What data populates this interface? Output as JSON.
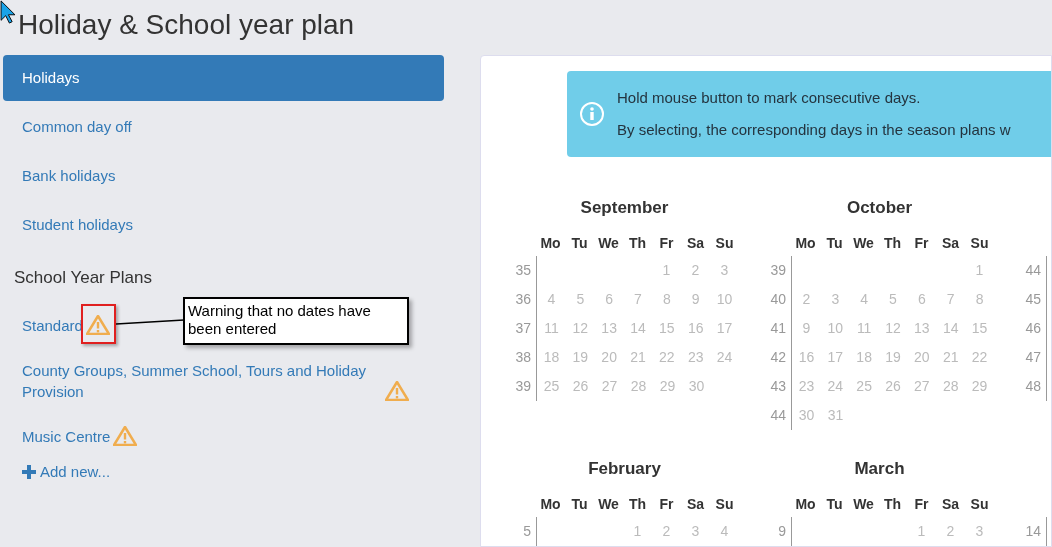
{
  "page_title": "Holiday & School year plan",
  "nav": [
    {
      "label": "Holidays",
      "selected": true
    },
    {
      "label": "Common day off",
      "selected": false
    },
    {
      "label": "Bank holidays",
      "selected": false
    },
    {
      "label": "Student holidays",
      "selected": false
    }
  ],
  "plans_heading": "School Year Plans",
  "plans": [
    {
      "label": "Standard",
      "warning": true
    },
    {
      "label": "County Groups, Summer School, Tours and Holiday Provision",
      "warning": true
    },
    {
      "label": "Music Centre",
      "warning": true
    }
  ],
  "add_new": "Add new...",
  "annotation": {
    "text": "Warning that no dates have been entered"
  },
  "info": {
    "lines": [
      "Hold mouse button to mark consecutive days.",
      "By selecting, the corresponding days in the season plans w"
    ]
  },
  "calendar": {
    "month_rows": [
      [
        {
          "title": "September",
          "weekdays": [
            "Mo",
            "Tu",
            "We",
            "Th",
            "Fr",
            "Sa",
            "Su"
          ],
          "weeks": [
            {
              "number": "35",
              "starts_mid_week": true,
              "days": [
                "1",
                "2",
                "3"
              ]
            },
            {
              "number": "36",
              "days": [
                "4",
                "5",
                "6",
                "7",
                "8",
                "9",
                "10"
              ]
            },
            {
              "number": "37",
              "days": [
                "11",
                "12",
                "13",
                "14",
                "15",
                "16",
                "17"
              ]
            },
            {
              "number": "38",
              "days": [
                "18",
                "19",
                "20",
                "21",
                "22",
                "23",
                "24"
              ]
            },
            {
              "number": "39",
              "starts_mid_week": false,
              "days": [
                "25",
                "26",
                "27",
                "28",
                "29",
                "30"
              ]
            }
          ]
        },
        {
          "title": "October",
          "weekdays": [
            "Mo",
            "Tu",
            "We",
            "Th",
            "Fr",
            "Sa",
            "Su"
          ],
          "weeks": [
            {
              "number": "39",
              "starts_mid_week": true,
              "days": [
                "1"
              ]
            },
            {
              "number": "40",
              "days": [
                "2",
                "3",
                "4",
                "5",
                "6",
                "7",
                "8"
              ]
            },
            {
              "number": "41",
              "days": [
                "9",
                "10",
                "11",
                "12",
                "13",
                "14",
                "15"
              ]
            },
            {
              "number": "42",
              "days": [
                "16",
                "17",
                "18",
                "19",
                "20",
                "21",
                "22"
              ]
            },
            {
              "number": "43",
              "days": [
                "23",
                "24",
                "25",
                "26",
                "27",
                "28",
                "29"
              ]
            },
            {
              "number": "44",
              "starts_mid_week": false,
              "days": [
                "30",
                "31"
              ]
            }
          ]
        },
        {
          "weeks": [
            {
              "number": "44"
            },
            {
              "number": "45"
            },
            {
              "number": "46"
            },
            {
              "number": "47"
            },
            {
              "number": "48"
            }
          ]
        }
      ],
      [
        {
          "title": "February",
          "weekdays": [
            "Mo",
            "Tu",
            "We",
            "Th",
            "Fr",
            "Sa",
            "Su"
          ],
          "weeks": [
            {
              "number": "5",
              "starts_mid_week": true,
              "days": [
                "1",
                "2",
                "3",
                "4"
              ]
            }
          ]
        },
        {
          "title": "March",
          "weekdays": [
            "Mo",
            "Tu",
            "We",
            "Th",
            "Fr",
            "Sa",
            "Su"
          ],
          "weeks": [
            {
              "number": "9",
              "starts_mid_week": true,
              "days": [
                "1",
                "2",
                "3"
              ]
            }
          ]
        },
        {
          "weeks": [
            {
              "number": "14"
            }
          ]
        }
      ]
    ]
  }
}
